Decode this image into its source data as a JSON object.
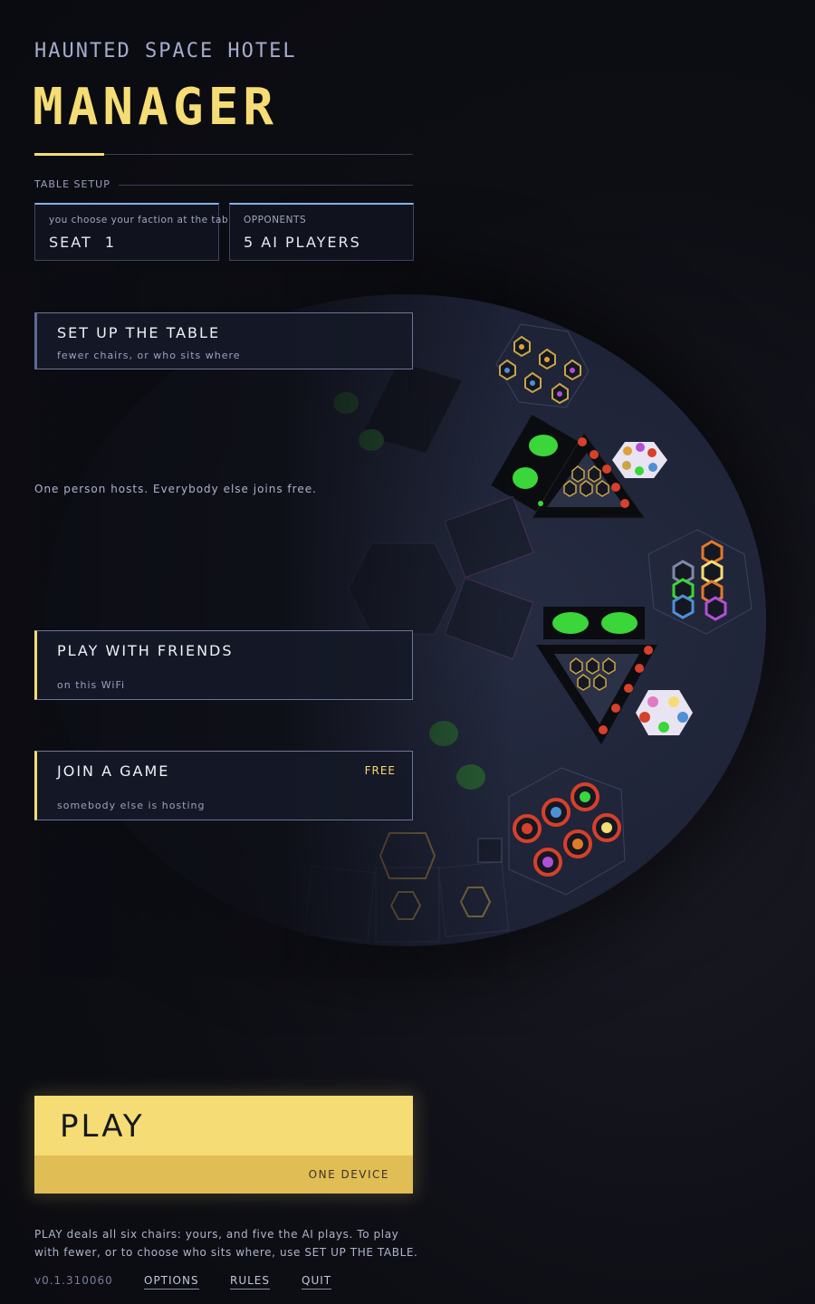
{
  "header": {
    "subtitle": "HAUNTED SPACE HOTEL",
    "title": "MANAGER"
  },
  "table_setup": {
    "section_label": "TABLE SETUP",
    "seat": {
      "caption": "you choose your faction at the table",
      "value": "SEAT  1"
    },
    "opponents": {
      "caption": "OPPONENTS",
      "value": "5 AI PLAYERS"
    }
  },
  "menu": {
    "setup_table": {
      "label": "SET UP THE TABLE",
      "sub": "fewer chairs, or who sits where"
    },
    "host_note": "One person hosts. Everybody else joins free.",
    "play_friends": {
      "label": "PLAY WITH FRIENDS",
      "sub": "on this WiFi"
    },
    "join_game": {
      "label": "JOIN A GAME",
      "sub": "somebody else is hosting",
      "tag": "FREE"
    }
  },
  "play": {
    "label": "PLAY",
    "sub": "ONE DEVICE"
  },
  "footer": {
    "note": "PLAY deals all six chairs: yours, and five the AI plays. To play with fewer, or to choose who sits where, use SET UP THE TABLE.",
    "version": "v0.1.310060",
    "links": {
      "options": "OPTIONS",
      "rules": "RULES",
      "quit": "QUIT"
    }
  },
  "colors": {
    "accent": "#f5dc74",
    "accent_dark": "#e0bd55",
    "board": "#222840",
    "creature_green": "#3ad63a",
    "token_red": "#d7402a"
  },
  "board_icons": [
    "hex-tile-cluster",
    "creature-card",
    "triangle-board",
    "token-chips",
    "hex-tokens"
  ]
}
